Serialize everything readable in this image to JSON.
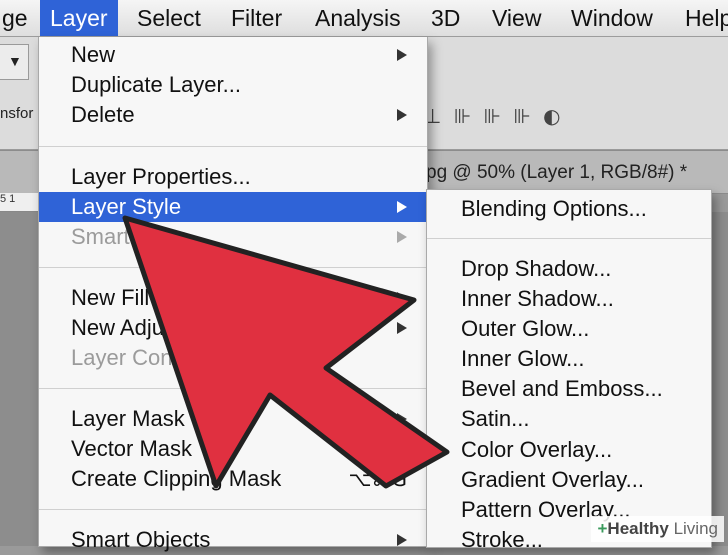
{
  "menubar": {
    "items": [
      {
        "label": "ge"
      },
      {
        "label": "Layer"
      },
      {
        "label": "Select"
      },
      {
        "label": "Filter"
      },
      {
        "label": "Analysis"
      },
      {
        "label": "3D"
      },
      {
        "label": "View"
      },
      {
        "label": "Window"
      },
      {
        "label": "Help"
      }
    ],
    "active_index": 1
  },
  "background": {
    "options_label": "nsfor",
    "document_title": "pg @ 50% (Layer 1, RGB/8#) *",
    "ruler_numbers": "5   1",
    "align_icons": "⊥ ⊪ ⊪ ⊪  ◐",
    "dropdown_glyph": "▼"
  },
  "layer_menu": {
    "items": [
      {
        "label": "New",
        "submenu": true
      },
      {
        "label": "Duplicate Layer..."
      },
      {
        "label": "Delete",
        "submenu": true
      },
      {
        "label": "Layer Properties..."
      },
      {
        "label": "Layer Style",
        "submenu": true,
        "highlighted": true
      },
      {
        "label": "Smart Filter",
        "submenu": true,
        "disabled": true
      },
      {
        "label": "New Fill Layer",
        "submenu": true
      },
      {
        "label": "New Adjustment Layer",
        "submenu": true
      },
      {
        "label": "Layer Content Options...",
        "disabled": true
      },
      {
        "label": "Layer Mask",
        "submenu": true
      },
      {
        "label": "Vector Mask",
        "submenu": true
      },
      {
        "label": "Create Clipping Mask",
        "shortcut": "⌥⌘G"
      },
      {
        "label": "Smart Objects",
        "submenu": true
      }
    ]
  },
  "layer_style_submenu": {
    "items": [
      {
        "label": "Blending Options..."
      },
      {
        "label": "Drop Shadow..."
      },
      {
        "label": "Inner Shadow..."
      },
      {
        "label": "Outer Glow..."
      },
      {
        "label": "Inner Glow..."
      },
      {
        "label": "Bevel and Emboss..."
      },
      {
        "label": "Satin..."
      },
      {
        "label": "Color Overlay..."
      },
      {
        "label": "Gradient Overlay..."
      },
      {
        "label": "Pattern Overlay..."
      },
      {
        "label": "Stroke..."
      }
    ]
  },
  "watermark": {
    "plus": "+",
    "word1": "Healthy",
    "word2": "Living"
  },
  "colors": {
    "highlight": "#2f63d7",
    "arrow_fill": "#e03040",
    "arrow_stroke": "#222222"
  }
}
